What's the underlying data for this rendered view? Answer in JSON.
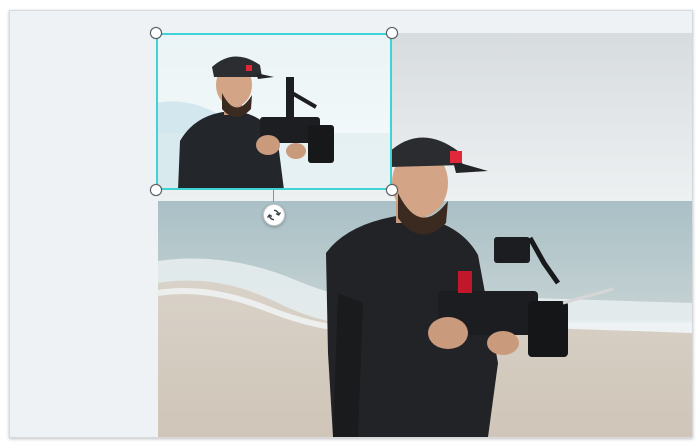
{
  "editor": {
    "canvas_background": "#eef2f4",
    "selection_color": "#3fd3d6",
    "main_layer": {
      "name": "main-photo",
      "subject": "videographer-with-cinema-camera-on-beach"
    },
    "overlay_layer": {
      "name": "picture-in-picture-photo",
      "subject": "videographer-close-up"
    },
    "icons": {
      "rotate": "rotate-icon",
      "resize_handles": [
        "top-left",
        "top-right",
        "bottom-left",
        "bottom-right"
      ]
    },
    "logo_mark": {
      "color": "#e0283a"
    }
  }
}
